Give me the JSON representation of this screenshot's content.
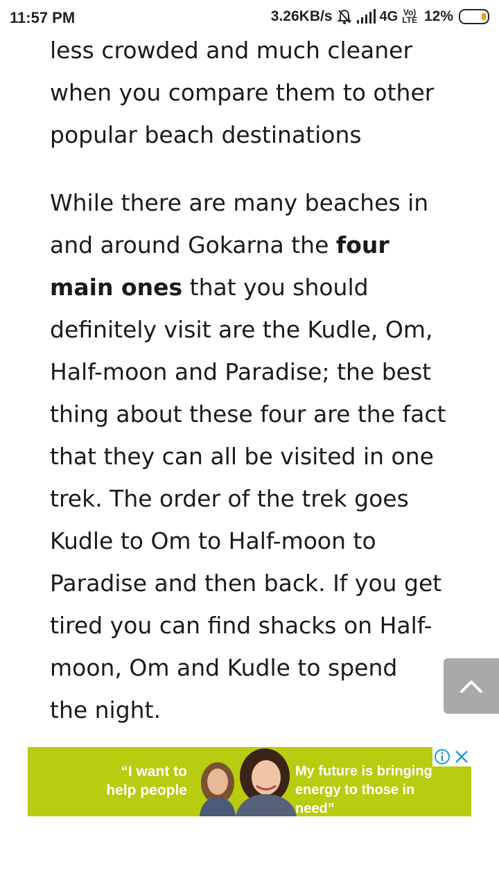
{
  "status_bar": {
    "time": "11:57 PM",
    "speed": "3.26KB/s",
    "network": "4G",
    "volte_top": "Vo)",
    "volte_bottom": "LTE",
    "battery": "12%",
    "battery_level": 0.12,
    "icons": [
      "bell-off-icon",
      "signal-icon",
      "battery-icon"
    ]
  },
  "article": {
    "lines_p1": [
      "less crowded and much cleaner",
      "when you compare them to other",
      "popular beach destinations"
    ],
    "p2_line1": "While there are many beaches in",
    "p2_line2_normal": "and around Gokarna the ",
    "p2_line2_bold": "four",
    "p2_line3_bold": "main ones",
    "p2_line3_normal": " that you should",
    "lines_p2_rest": [
      "definitely visit are the Kudle, Om,",
      "Half-moon and Paradise; the best",
      "thing about these four are the fact",
      "that they can all be visited in one",
      "trek. The order of the trek goes",
      "Kudle to Om to Half-moon to",
      "Paradise and then back. If you get",
      "tired you can find shacks on Half-",
      "moon, Om and Kudle to spend",
      "the night."
    ]
  },
  "scroll_top": {
    "icon": "chevron-up-icon"
  },
  "ad": {
    "left_quote": "“I want to help people",
    "right_quote": "My future is bringing energy to those in need”",
    "background": "#b8cc10",
    "info_icon": "info-icon",
    "close_icon": "close-icon"
  }
}
